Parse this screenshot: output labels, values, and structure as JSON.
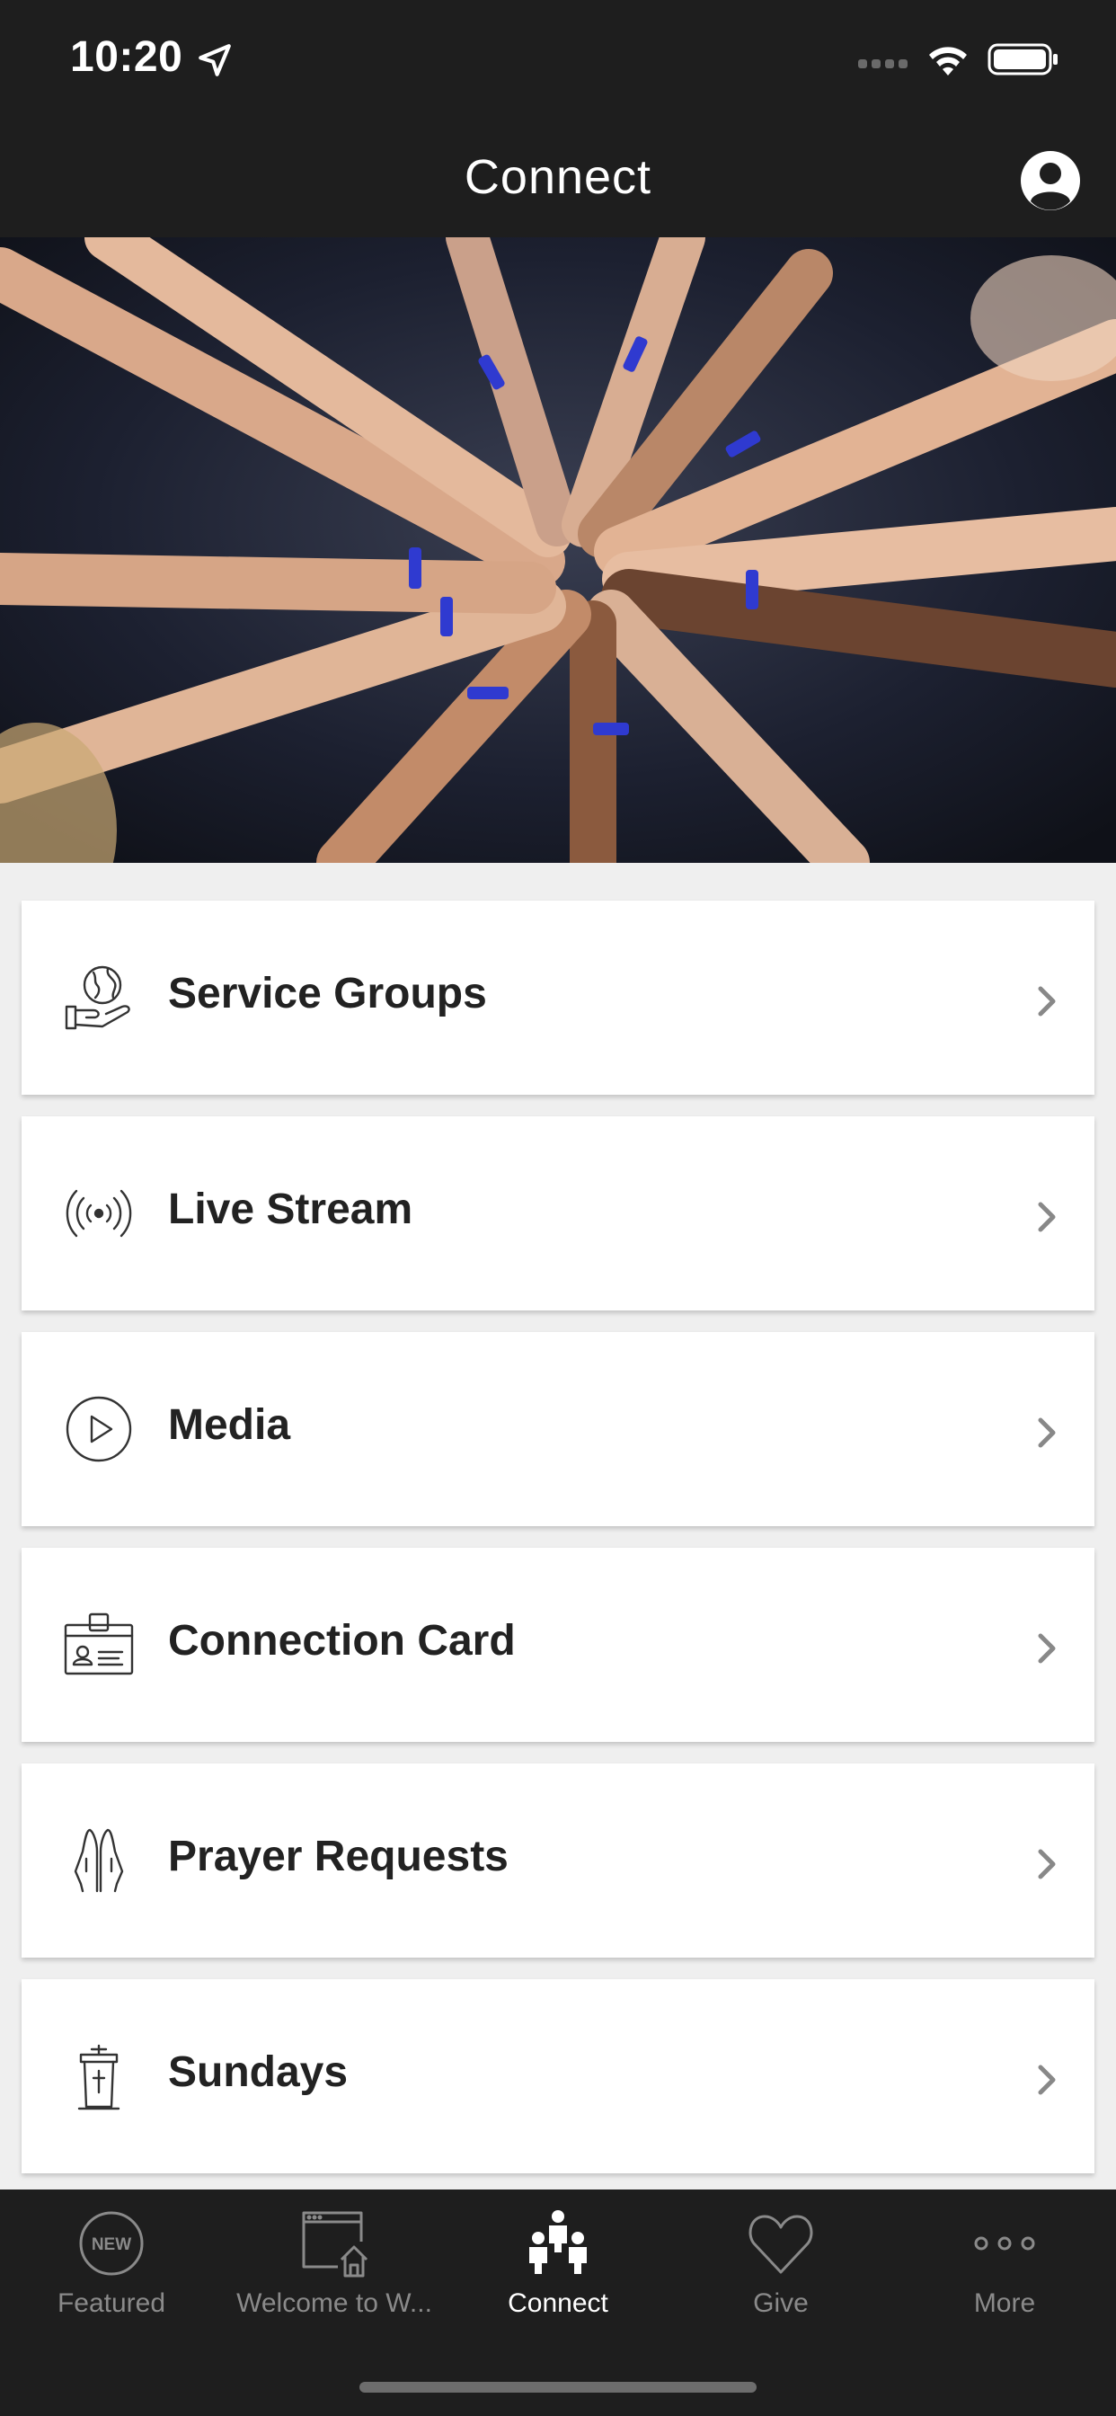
{
  "status_bar": {
    "time": "10:20",
    "location_icon": "location-arrow-icon",
    "signal_icon": "cellular-dots-icon",
    "wifi_icon": "wifi-icon",
    "battery_icon": "battery-icon"
  },
  "nav": {
    "title": "Connect",
    "profile_icon": "user-profile-icon"
  },
  "hero": {
    "description_icon": "hands-together-photo"
  },
  "menu": {
    "items": [
      {
        "label": "Service Groups",
        "icon": "globe-in-hand-icon"
      },
      {
        "label": "Live Stream",
        "icon": "broadcast-icon"
      },
      {
        "label": "Media",
        "icon": "play-circle-icon"
      },
      {
        "label": "Connection Card",
        "icon": "id-card-icon"
      },
      {
        "label": "Prayer Requests",
        "icon": "praying-hands-icon"
      },
      {
        "label": "Sundays",
        "icon": "pulpit-icon"
      }
    ]
  },
  "tabs": [
    {
      "label": "Featured",
      "icon": "new-badge-icon",
      "active": false
    },
    {
      "label": "Welcome to W...",
      "icon": "browser-home-icon",
      "active": false
    },
    {
      "label": "Connect",
      "icon": "people-group-icon",
      "active": true
    },
    {
      "label": "Give",
      "icon": "heart-icon",
      "active": false
    },
    {
      "label": "More",
      "icon": "more-dots-icon",
      "active": false
    }
  ],
  "new_badge_text": "NEW",
  "colors": {
    "bar_background": "#1e1e1e",
    "page_background": "#efefef",
    "card_background": "#ffffff",
    "label_text": "#222222",
    "tab_inactive": "#8a8a8a",
    "tab_active": "#ffffff"
  }
}
